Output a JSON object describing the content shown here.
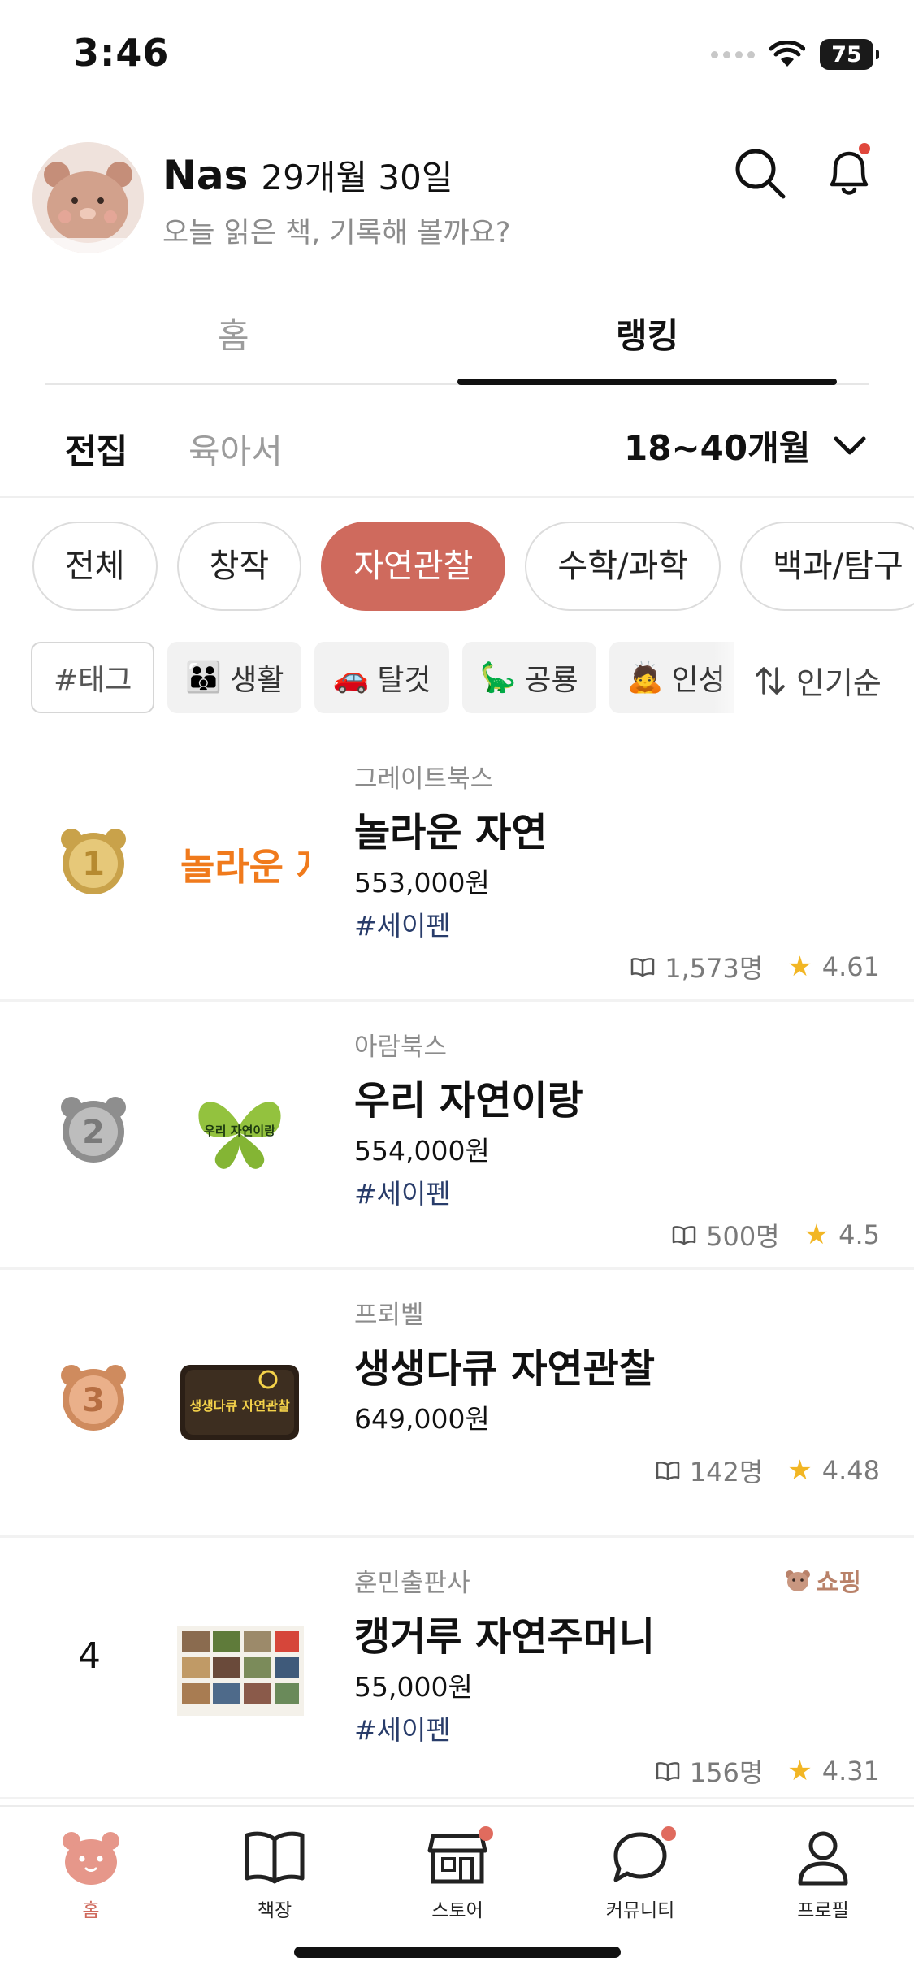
{
  "status_bar": {
    "time": "3:46",
    "battery": "75"
  },
  "header": {
    "name": "Nas",
    "age": "29개월 30일",
    "prompt": "오늘 읽은 책, 기록해 볼까요?"
  },
  "main_tabs": [
    {
      "label": "홈",
      "active": false
    },
    {
      "label": "랭킹",
      "active": true
    }
  ],
  "sub_tabs": [
    {
      "label": "전집",
      "active": true
    },
    {
      "label": "육아서",
      "active": false
    }
  ],
  "age_filter": {
    "value": "18~40개월"
  },
  "categories": [
    {
      "label": "전체",
      "active": false
    },
    {
      "label": "창작",
      "active": false
    },
    {
      "label": "자연관찰",
      "active": true
    },
    {
      "label": "수학/과학",
      "active": false
    },
    {
      "label": "백과/탐구",
      "active": false
    }
  ],
  "tags": {
    "input_label": "#태그",
    "chips": [
      {
        "emoji": "👪",
        "label": "생활"
      },
      {
        "emoji": "🚗",
        "label": "탈것"
      },
      {
        "emoji": "🦕",
        "label": "공룡"
      },
      {
        "emoji": "🙇",
        "label": "인성"
      }
    ]
  },
  "sort": {
    "label": "인기순"
  },
  "rankings": [
    {
      "rank": "1",
      "publisher": "그레이트북스",
      "title": "놀라운 자연",
      "price": "553,000원",
      "tag": "#세이펜",
      "readers": "1,573명",
      "rating": "4.61",
      "thumb_text": "놀라운 자연"
    },
    {
      "rank": "2",
      "publisher": "아람북스",
      "title": "우리 자연이랑",
      "price": "554,000원",
      "tag": "#세이펜",
      "readers": "500명",
      "rating": "4.5",
      "thumb_text": "우리 자연이랑"
    },
    {
      "rank": "3",
      "publisher": "프뢰벨",
      "title": "생생다큐 자연관찰",
      "price": "649,000원",
      "tag": "",
      "readers": "142명",
      "rating": "4.48",
      "thumb_text": "생생다큐 자연관찰"
    },
    {
      "rank": "4",
      "publisher": "훈민출판사",
      "title": "캥거루 자연주머니",
      "price": "55,000원",
      "tag": "#세이펜",
      "readers": "156명",
      "rating": "4.31",
      "badge": "쇼핑"
    }
  ],
  "bottom_nav": [
    {
      "label": "홈",
      "icon": "bear-home-icon",
      "active": true
    },
    {
      "label": "책장",
      "icon": "book-icon",
      "active": false
    },
    {
      "label": "스토어",
      "icon": "store-icon",
      "active": false
    },
    {
      "label": "커뮤니티",
      "icon": "chat-icon",
      "active": false
    },
    {
      "label": "프로필",
      "icon": "person-icon",
      "active": false
    }
  ],
  "colors": {
    "accent": "#cf6a5d",
    "tag_blue": "#283c6a",
    "star": "#f2b624",
    "muted": "#9c9c9c"
  }
}
